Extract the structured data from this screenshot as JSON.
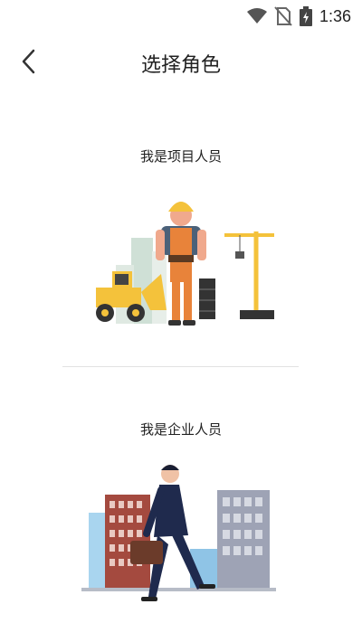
{
  "status": {
    "time": "1:36"
  },
  "header": {
    "title": "选择角色"
  },
  "roles": [
    {
      "label": "我是项目人员"
    },
    {
      "label": "我是企业人员"
    }
  ],
  "colors": {
    "accent_yellow": "#f4c23b",
    "orange": "#e8833a",
    "navy": "#1f2a4d",
    "brick": "#a44a3f"
  }
}
